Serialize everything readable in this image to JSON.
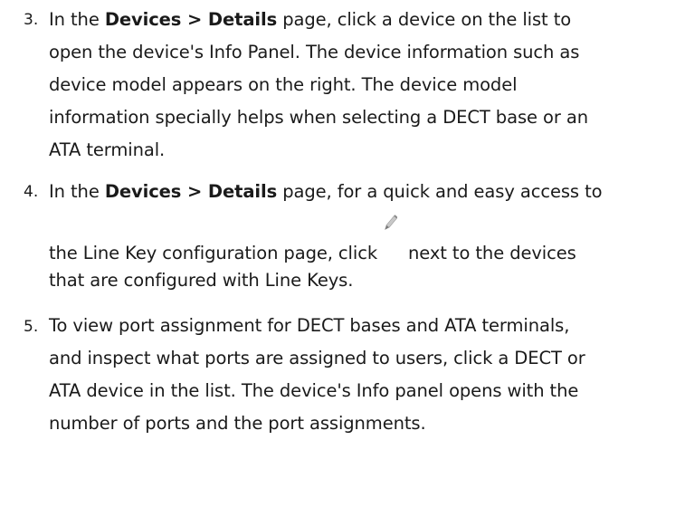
{
  "steps": [
    {
      "number": "3.",
      "lines": [
        {
          "pre": "In the ",
          "bold": "Devices > Details",
          "post": " page, click a device on the list to"
        },
        {
          "text": "open the device's Info Panel. The device information such as"
        },
        {
          "text": "device model appears on the right. The device model"
        },
        {
          "text": "information specially helps when selecting a DECT base or an"
        },
        {
          "text": "ATA terminal."
        }
      ]
    },
    {
      "number": "4.",
      "lines": [
        {
          "pre": "In the ",
          "bold": "Devices > Details",
          "post": " page, for a quick and easy access to"
        },
        {
          "pre": "the Line Key configuration page, click",
          "icon": "pencil-edit-icon",
          "post": "next to the devices"
        },
        {
          "text": "that are configured with Line Keys."
        }
      ]
    },
    {
      "number": "5.",
      "lines": [
        {
          "text": "To view port assignment for DECT bases and ATA terminals,"
        },
        {
          "text": "and inspect what ports are assigned to users, click a DECT or"
        },
        {
          "text": "ATA device in the list. The device's Info panel opens with the"
        },
        {
          "text": "number of ports and the port assignments."
        }
      ]
    }
  ],
  "colors": {
    "text": "#1a1a1a",
    "pencil_body": "#c8c8c8",
    "pencil_tip": "#7a7a7a"
  }
}
